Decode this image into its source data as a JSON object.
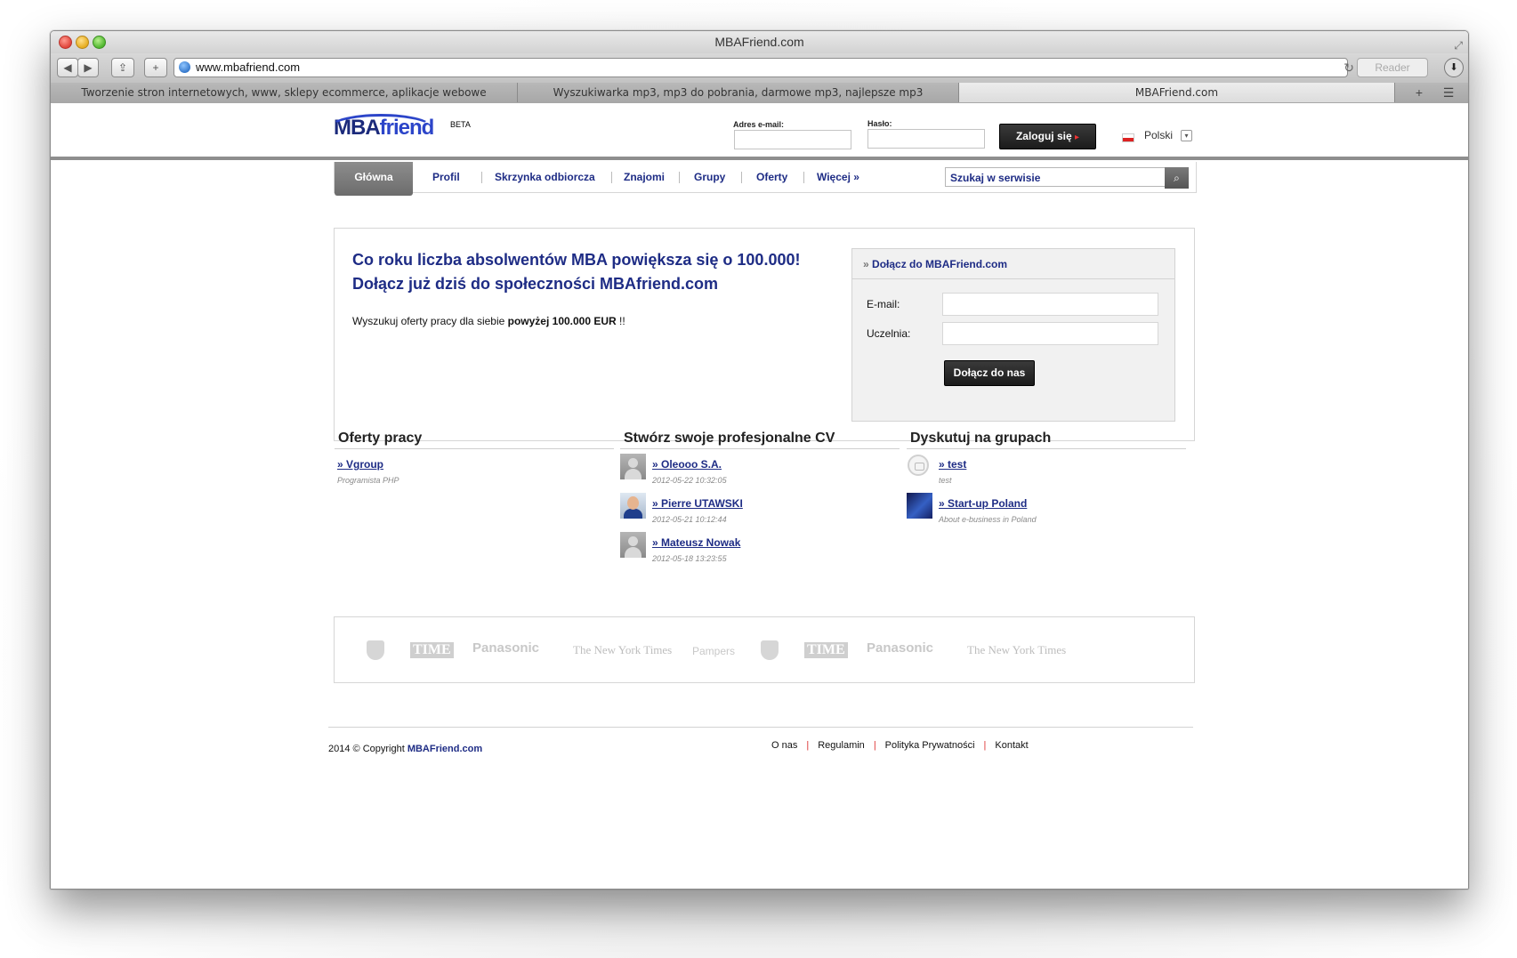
{
  "window": {
    "title": "MBAFriend.com"
  },
  "toolbar": {
    "url": "www.mbafriend.com",
    "reader_label": "Reader"
  },
  "tabs": [
    {
      "label": "Tworzenie stron internetowych, www, sklepy ecommerce, aplikacje webowe"
    },
    {
      "label": "Wyszukiwarka mp3, mp3 do pobrania, darmowe mp3, najlepsze mp3"
    },
    {
      "label": "MBAFriend.com"
    }
  ],
  "header": {
    "logo_mba": "MBA",
    "logo_friend": "friend",
    "logo_beta": "BETA",
    "email_label": "Adres e-mail:",
    "password_label": "Hasło:",
    "login_button": "Zaloguj się",
    "language": "Polski"
  },
  "nav": {
    "home": "Główna",
    "items": [
      "Profil",
      "Skrzynka odbiorcza",
      "Znajomi",
      "Grupy",
      "Oferty",
      "Więcej »"
    ],
    "search_placeholder": "Szukaj w serwisie"
  },
  "hero": {
    "headline_line1": "Co roku liczba absolwentów MBA powiększa się o 100.000!",
    "headline_line2": "Dołącz już dziś do społeczności MBAfriend.com",
    "sub_text": "Wyszukuj oferty pracy dla siebie ",
    "sub_bold": "powyżej 100.000 EUR",
    "sub_tail": " !!"
  },
  "join": {
    "title": "Dołącz do MBAFriend.com",
    "email_label": "E-mail:",
    "school_label": "Uczelnia:",
    "submit": "Dołącz do nas"
  },
  "columns": {
    "jobs": {
      "title": "Oferty pracy",
      "items": [
        {
          "link": "» Vgroup",
          "meta": "Programista PHP"
        }
      ]
    },
    "cv": {
      "title": "Stwórz swoje profesjonalne CV",
      "items": [
        {
          "link": "» Oleooo S.A.",
          "meta": "2012-05-22 10:32:05",
          "avatar": "gray-avatar"
        },
        {
          "link": "» Pierre UTAWSKI",
          "meta": "2012-05-21 10:12:44",
          "avatar": "person-avatar"
        },
        {
          "link": "» Mateusz Nowak",
          "meta": "2012-05-18 13:23:55",
          "avatar": "gray-avatar"
        }
      ]
    },
    "groups": {
      "title": "Dyskutuj na grupach",
      "items": [
        {
          "link": "» test",
          "meta": "test",
          "avatar": "group-circle-icon"
        },
        {
          "link": "» Start-up Poland",
          "meta": "About e-business in Poland",
          "avatar": "startup-avatar"
        }
      ]
    }
  },
  "logos": [
    "TIME",
    "Panasonic",
    "The New York Times",
    "Pampers",
    "TIME",
    "Panasonic",
    "The New York Times"
  ],
  "footer": {
    "copyright": "2014 © Copyright ",
    "brand": "MBAFriend.com",
    "links": [
      "O nas",
      "Regulamin",
      "Polityka Prywatności",
      "Kontakt"
    ]
  }
}
